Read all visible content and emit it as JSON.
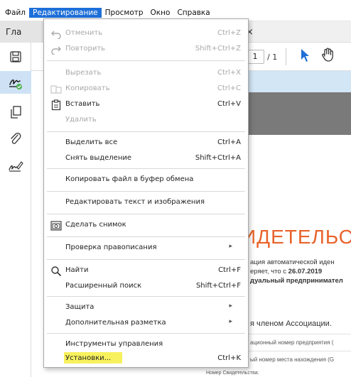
{
  "menubar": {
    "items": [
      "Файл",
      "Редактирование",
      "Просмотр",
      "Окно",
      "Справка"
    ],
    "active_index": 1
  },
  "tabs": {
    "home_label": "Гла",
    "close_glyph": "×"
  },
  "toolbar": {
    "page_current": "1",
    "page_total": "/ 1"
  },
  "sidebar": {
    "icons": [
      "save-icon",
      "fill-sign-icon",
      "pages-icon",
      "attach-icon",
      "sign-icon"
    ]
  },
  "menu": {
    "items": {
      "undo": {
        "label": "Отменить",
        "shortcut": "Ctrl+Z"
      },
      "redo": {
        "label": "Повторить",
        "shortcut": "Shift+Ctrl+Z"
      },
      "cut": {
        "label": "Вырезать",
        "shortcut": "Ctrl+X"
      },
      "copy": {
        "label": "Копировать",
        "shortcut": "Ctrl+C"
      },
      "paste": {
        "label": "Вставить",
        "shortcut": "Ctrl+V"
      },
      "delete": {
        "label": "Удалить"
      },
      "select_all": {
        "label": "Выделить все",
        "shortcut": "Ctrl+A"
      },
      "deselect": {
        "label": "Снять выделение",
        "shortcut": "Shift+Ctrl+A"
      },
      "copy_file": {
        "label": "Копировать файл в буфер обмена"
      },
      "edit_text": {
        "label": "Редактировать текст и изображения"
      },
      "snapshot": {
        "label": "Сделать снимок"
      },
      "spelling": {
        "label": "Проверка правописания"
      },
      "find": {
        "label": "Найти",
        "shortcut": "Ctrl+F"
      },
      "adv_search": {
        "label": "Расширенный поиск",
        "shortcut": "Shift+Ctrl+F"
      },
      "protect": {
        "label": "Защита"
      },
      "markup": {
        "label": "Дополнительная разметка"
      },
      "tools": {
        "label": "Инструменты управления"
      },
      "prefs": {
        "label": "Установки...",
        "shortcut": "Ctrl+K"
      }
    },
    "submenu_glyph": "▸"
  },
  "document": {
    "title": "ИДЕТЕЛЬС",
    "line1": "ация автоматической иден",
    "line2_prefix": "еряет, что с",
    "line2_date": "26.07.2019",
    "line3": "дуальный предпринимател",
    "line4": "я членом Ассоциации.",
    "line5": "ационный номер предприятия (",
    "line6": "ый номер места нахождения (G",
    "line7": "Номер Свидетельства:"
  },
  "colors": {
    "menu_highlight": "#1e6fd9",
    "doc_title": "#e8632b",
    "hover_highlight": "#f7f15e",
    "cursor_tool": "#1f6fd6"
  }
}
